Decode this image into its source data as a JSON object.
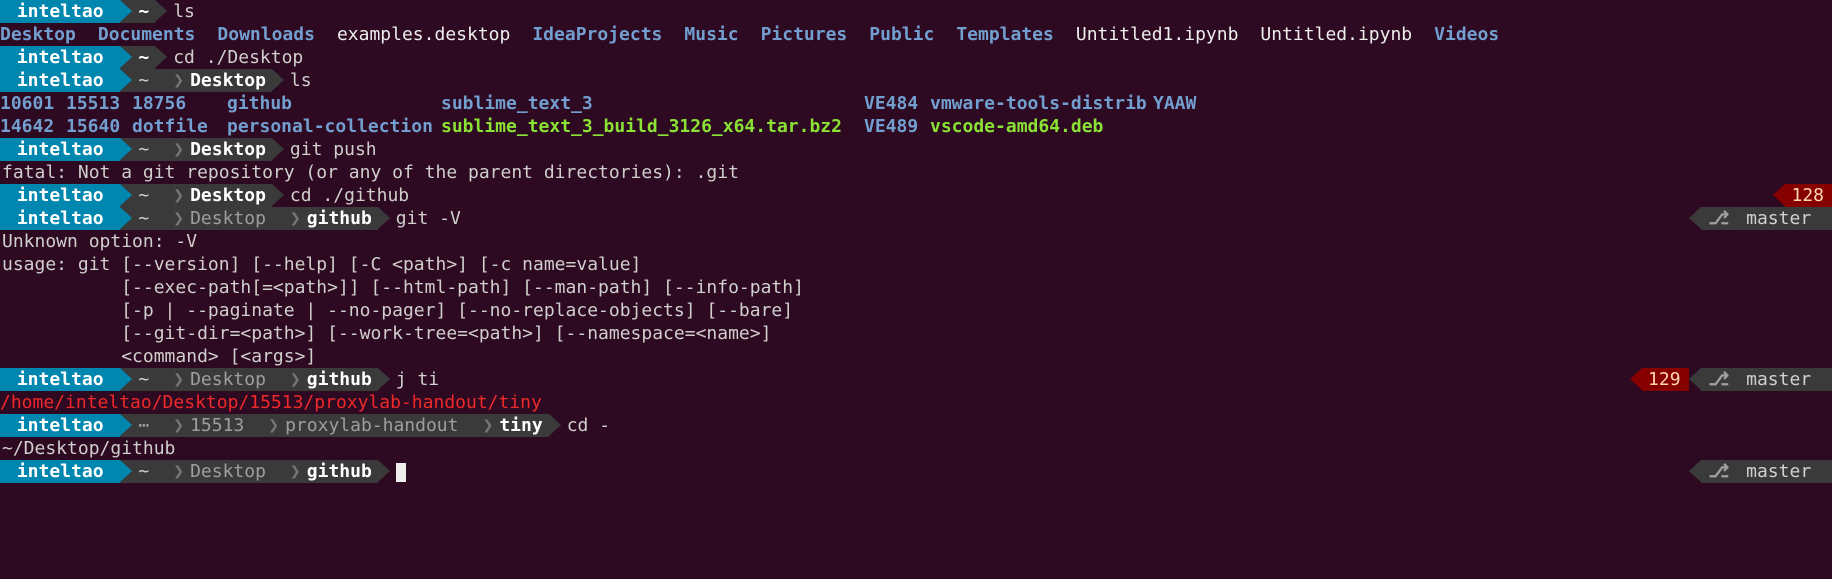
{
  "user": "inteltao",
  "home": "~",
  "desktop": "Desktop",
  "github": "github",
  "tiny": "tiny",
  "proxylab": "proxylab-handout",
  "n15513": "15513",
  "ellipsis": "⋯",
  "branch_icon": "⎇",
  "branch": "master",
  "err128": "128",
  "err129": "129",
  "cmd_ls": "ls",
  "cmd_cd_desktop": "cd ./Desktop",
  "cmd_gitpush": "git push",
  "cmd_cd_github": "cd ./github",
  "cmd_git_v": "git -V",
  "cmd_jti": "j ti",
  "cmd_cd_dash": "cd -",
  "ls_home": [
    {
      "t": "Desktop",
      "c": "blue"
    },
    {
      "t": "Documents",
      "c": "blue"
    },
    {
      "t": "Downloads",
      "c": "blue"
    },
    {
      "t": "examples.desktop",
      "c": "white"
    },
    {
      "t": "IdeaProjects",
      "c": "blue"
    },
    {
      "t": "Music",
      "c": "blue"
    },
    {
      "t": "Pictures",
      "c": "blue"
    },
    {
      "t": "Public",
      "c": "blue"
    },
    {
      "t": "Templates",
      "c": "blue"
    },
    {
      "t": "Untitled1.ipynb",
      "c": "white"
    },
    {
      "t": "Untitled.ipynb",
      "c": "white"
    },
    {
      "t": "Videos",
      "c": "blue"
    }
  ],
  "ls_desktop_r1": [
    {
      "t": "10601",
      "c": "blue"
    },
    {
      "t": "15513",
      "c": "blue"
    },
    {
      "t": "18756",
      "c": "blue"
    },
    {
      "t": "github",
      "c": "blue"
    },
    {
      "t": "sublime_text_3",
      "c": "blue"
    },
    {
      "t": "VE484",
      "c": "blue"
    },
    {
      "t": "vmware-tools-distrib",
      "c": "blue"
    },
    {
      "t": "YAAW",
      "c": "blue"
    }
  ],
  "ls_desktop_r2": [
    {
      "t": "14642",
      "c": "blue"
    },
    {
      "t": "15640",
      "c": "blue"
    },
    {
      "t": "dotfile",
      "c": "blue"
    },
    {
      "t": "personal-collection",
      "c": "blue"
    },
    {
      "t": "sublime_text_3_build_3126_x64.tar.bz2",
      "c": "green"
    },
    {
      "t": "VE489",
      "c": "blue"
    },
    {
      "t": "vscode-amd64.deb",
      "c": "green"
    }
  ],
  "fatal": "fatal: Not a git repository (or any of the parent directories): .git",
  "unknown": "Unknown option: -V",
  "usage1": "usage: git [--version] [--help] [-C <path>] [-c name=value]",
  "usage2": "           [--exec-path[=<path>]] [--html-path] [--man-path] [--info-path]",
  "usage3": "           [-p | --paginate | --no-pager] [--no-replace-objects] [--bare]",
  "usage4": "           [--git-dir=<path>] [--work-tree=<path>] [--namespace=<name>]",
  "usage5": "           <command> [<args>]",
  "tinypath": "/home/inteltao/Desktop/15513/proxylab-handout/tiny",
  "cd_out": "~/Desktop/github",
  "col_widths_desktop": [
    66,
    66,
    95,
    214,
    423,
    66,
    223,
    80
  ]
}
